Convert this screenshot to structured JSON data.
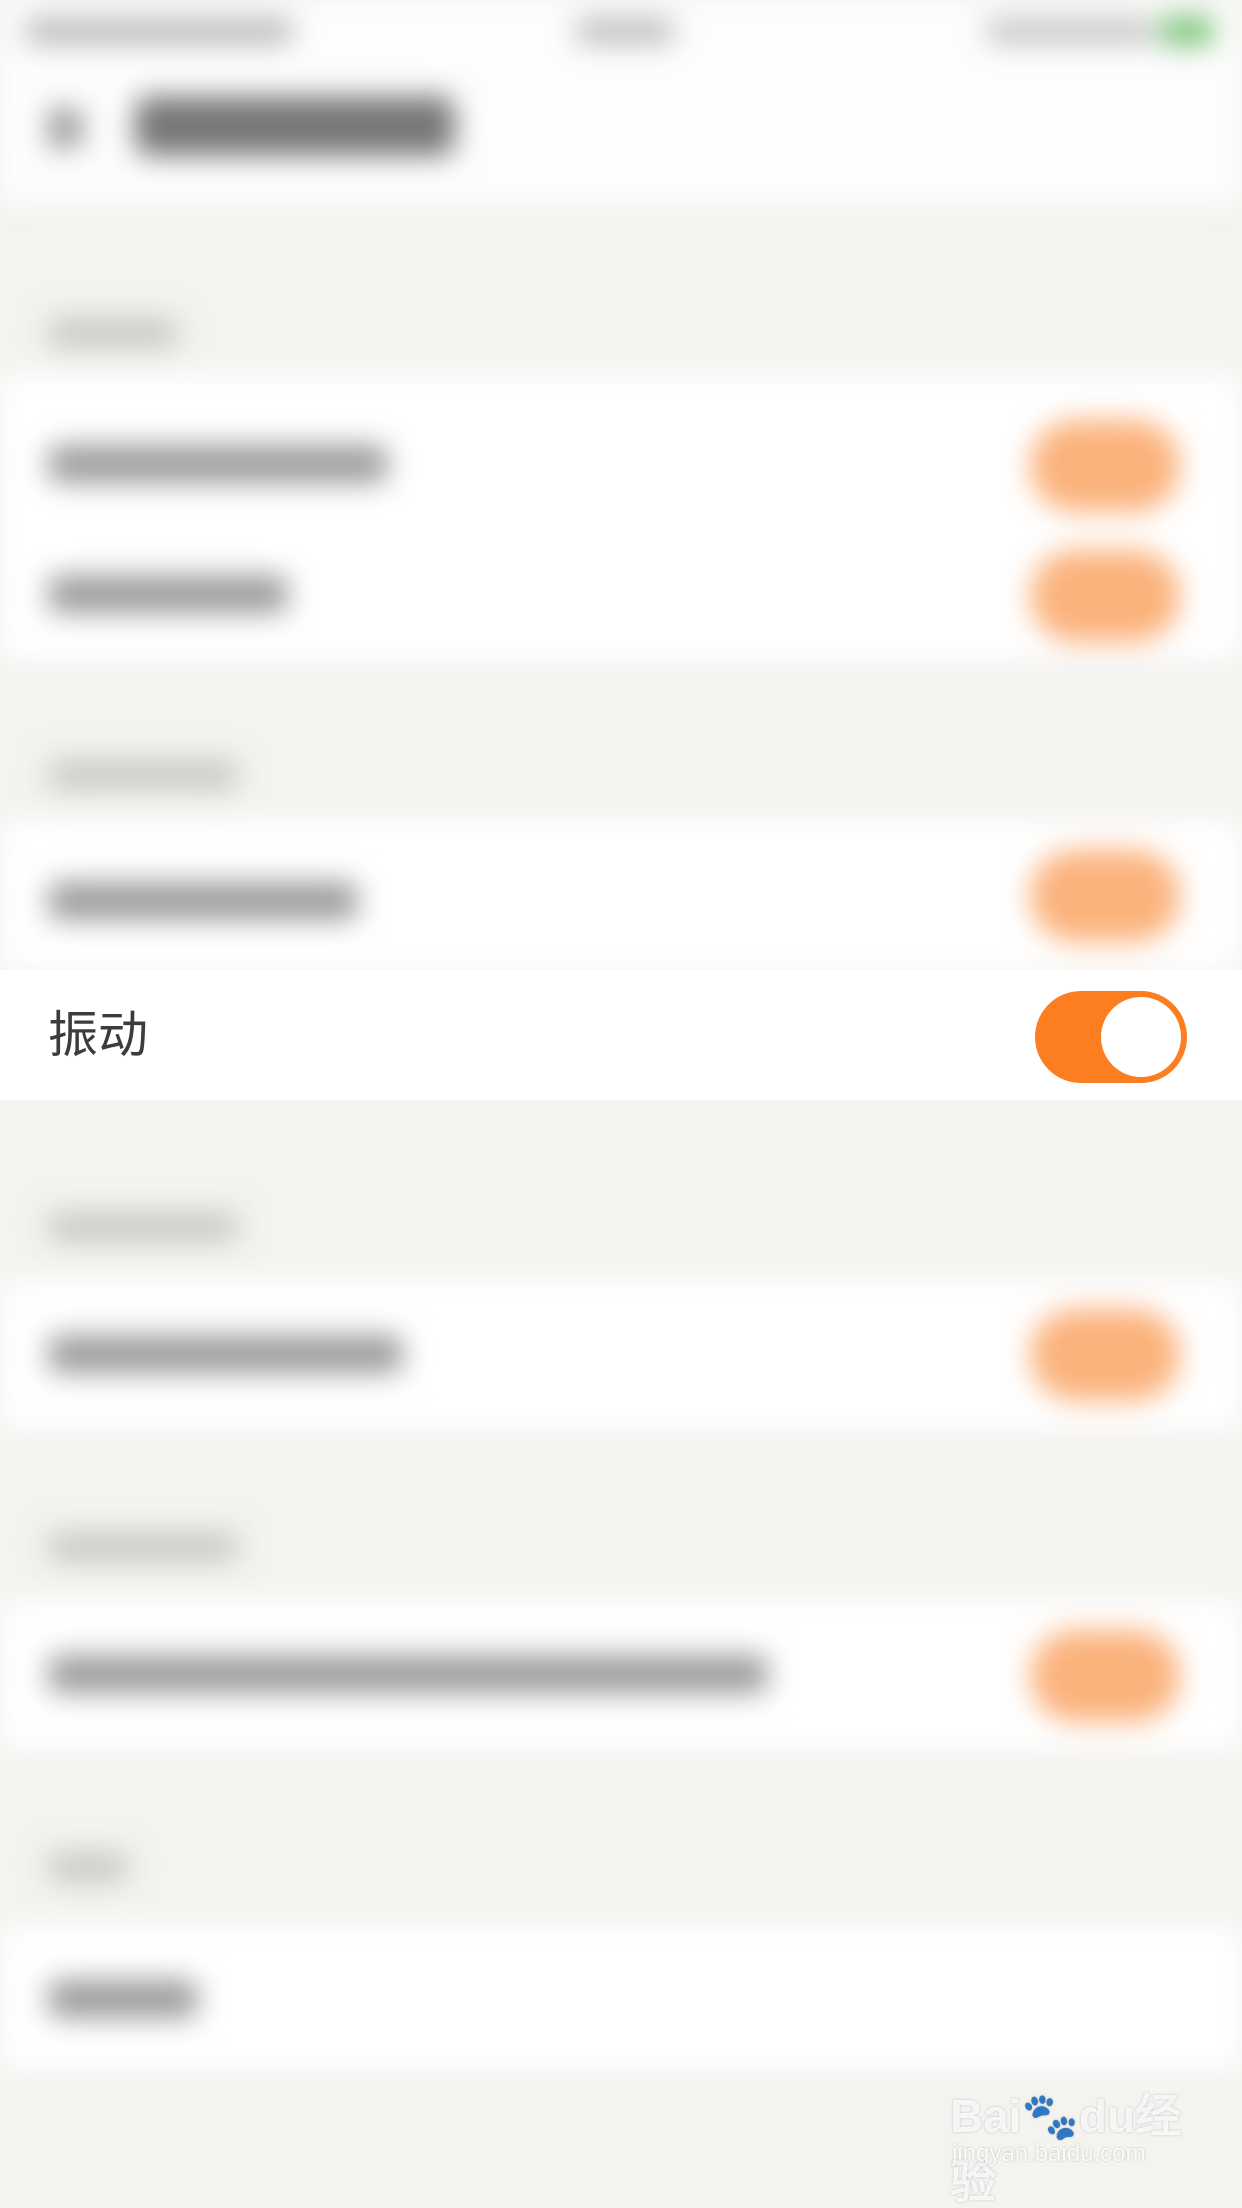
{
  "vibrate": {
    "label": "振动",
    "enabled": true,
    "accent_color": "#fd7d21"
  },
  "watermark": {
    "brand": "Bai",
    "brand_cn": "经验",
    "url": "jingyan.baidu.com",
    "icon": "paw-icon"
  }
}
